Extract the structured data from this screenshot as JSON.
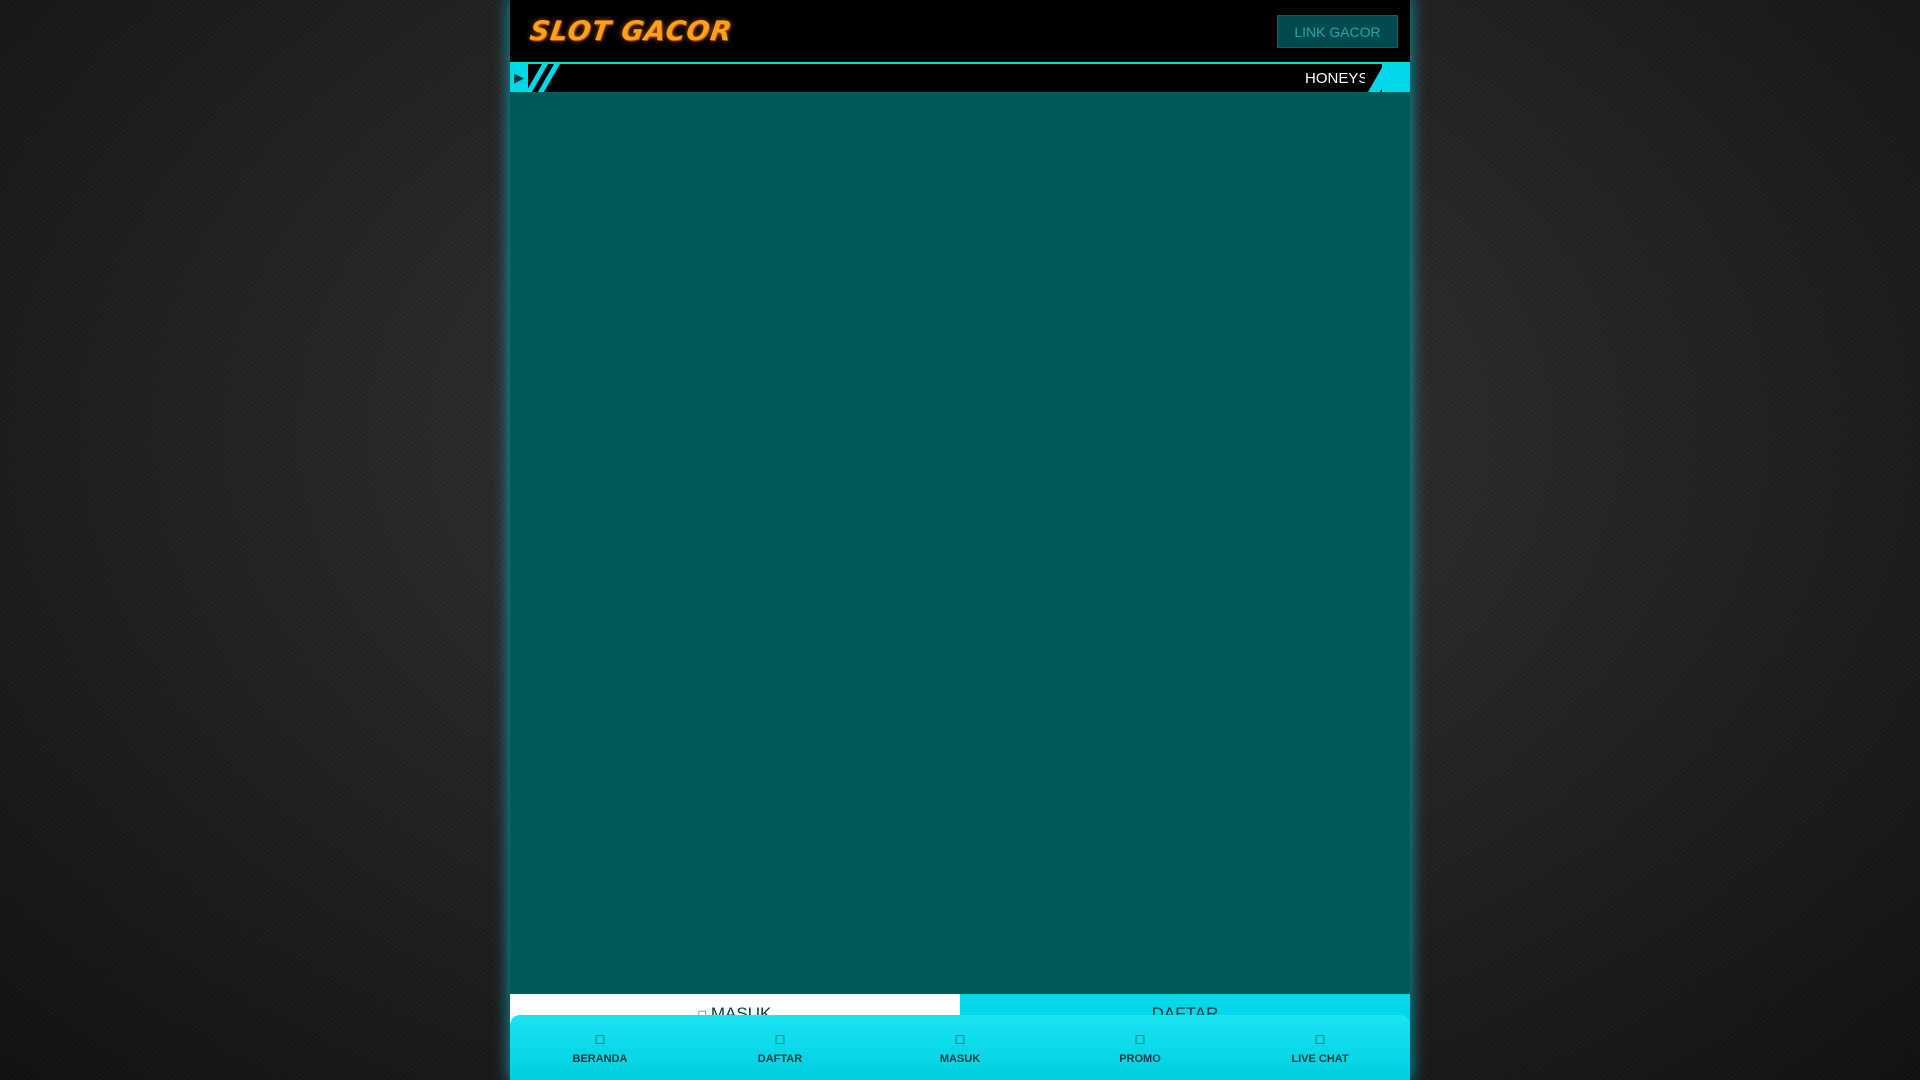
{
  "header": {
    "logo_text": "SLOT GACOR",
    "link_button": "LINK GACOR"
  },
  "marquee": {
    "icon": "speaker-icon",
    "text": "HONEYSL"
  },
  "actions": {
    "masuk_icon": "lock-icon",
    "masuk_label": "MASUK",
    "daftar_label": "DAFTAR"
  },
  "bottom_nav": {
    "items": [
      {
        "label": "BERANDA",
        "icon": "home-icon"
      },
      {
        "label": "DAFTAR",
        "icon": "user-plus-icon"
      },
      {
        "label": "MASUK",
        "icon": "sign-in-icon"
      },
      {
        "label": "PROMO",
        "icon": "gift-icon"
      },
      {
        "label": "LIVE CHAT",
        "icon": "chat-icon"
      }
    ]
  },
  "colors": {
    "accent": "#00d8ea",
    "main_bg": "#005a5a",
    "logo": "#ff9f1a"
  }
}
